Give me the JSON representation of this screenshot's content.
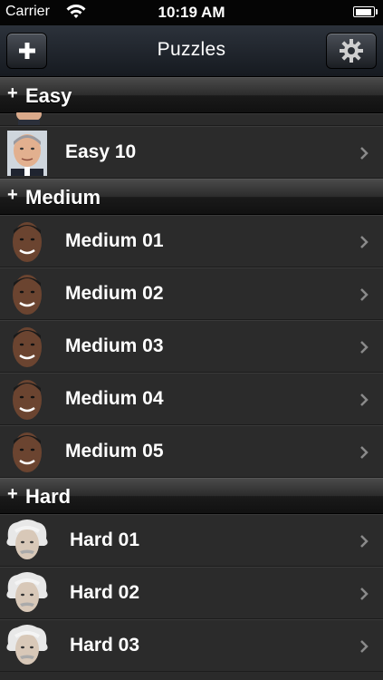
{
  "status_bar": {
    "carrier": "Carrier",
    "time": "10:19 AM",
    "battery_level": 1.0
  },
  "navbar": {
    "title": "Puzzles",
    "add_icon": "plus-icon",
    "settings_icon": "gear-icon"
  },
  "sections": {
    "easy": {
      "label": "Easy",
      "items": [
        {
          "label": "Easy 10",
          "avatar": "bush-face"
        }
      ]
    },
    "medium": {
      "label": "Medium",
      "items": [
        {
          "label": "Medium 01",
          "avatar": "obama-face"
        },
        {
          "label": "Medium 02",
          "avatar": "obama-face"
        },
        {
          "label": "Medium 03",
          "avatar": "obama-face"
        },
        {
          "label": "Medium 04",
          "avatar": "obama-face"
        },
        {
          "label": "Medium 05",
          "avatar": "obama-face"
        }
      ]
    },
    "hard": {
      "label": "Hard",
      "items": [
        {
          "label": "Hard 01",
          "avatar": "einstein-face"
        },
        {
          "label": "Hard 02",
          "avatar": "einstein-face"
        },
        {
          "label": "Hard 03",
          "avatar": "einstein-face"
        }
      ]
    }
  },
  "colors": {
    "navbar_top": "#2c323b",
    "navbar_bottom": "#161a20",
    "row_bg": "#2b2b2b",
    "text": "#ffffff"
  }
}
